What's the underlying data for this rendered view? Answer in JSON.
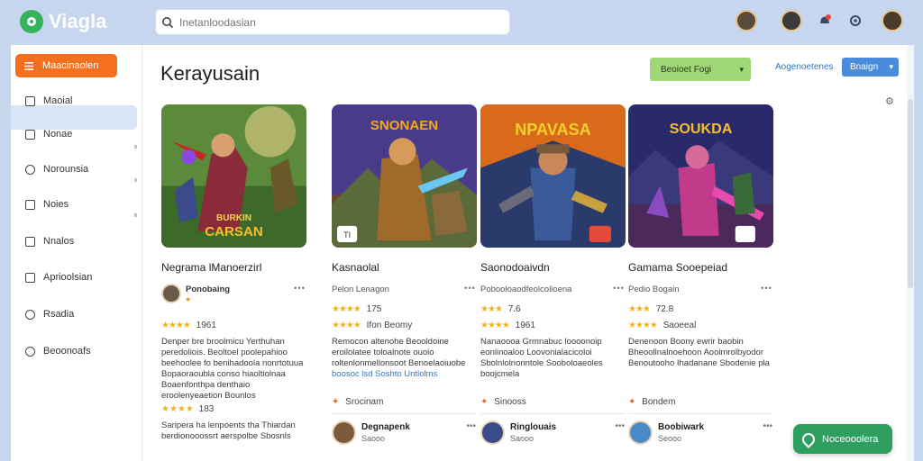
{
  "app": {
    "name": "Viagla"
  },
  "search": {
    "placeholder": "Inetanloodasian"
  },
  "sidebar": {
    "primary_label": "Maacinaolen",
    "items": [
      {
        "label": "Maoial",
        "icon": "document-icon"
      },
      {
        "label": "Nonae",
        "icon": "document-icon"
      },
      {
        "label": "Norounsia",
        "icon": "search-icon"
      },
      {
        "label": "Noies",
        "icon": "document-icon"
      },
      {
        "label": "Nnalos",
        "icon": "play-icon"
      },
      {
        "label": "Aprioolsian",
        "icon": "document-icon"
      },
      {
        "label": "Rsadia",
        "icon": "clock-icon"
      },
      {
        "label": "Beoonoafs",
        "icon": "shield-icon"
      }
    ]
  },
  "header": {
    "title": "Kerayusain",
    "filter_label": "Beoioet Fogi",
    "link_label": "Aogenoetenes",
    "sort_label": "Bnaign"
  },
  "cards": [
    {
      "name": "Negrama lManoerzirl",
      "meta": "Ponobaing",
      "rating": "1961",
      "desc": "Denper bre broolmicu Yerthuhan peredoliois. Beoltoel poolepahioo beehoolee fo benihadoola nonrtotuua Bopaoraoubla conso hiaoltiolnaa Boaenfonthpa denthaio eroolenyeaetion Bounlos",
      "rating2": "183",
      "desc2": "Saripera ha lenpoents tha Thiardan berdionooossrt aerspolbe Sbosnls",
      "thumb_text_top": "",
      "thumb_text_bottom": "BURKIN CARSAN",
      "colors": {
        "sky": "#6a9a3c",
        "ground": "#3d6a2a",
        "hero": "#b23a3a"
      }
    },
    {
      "name": "Kasnaolal",
      "meta": "Pelon Lenagon",
      "rating": "175",
      "rating_word": "Ifon Beomy",
      "desc": "Remocon altenohe Beooldoine eroilolatee toloalnote ouoio roltenlonmellonsoot Benoelaoiuobe",
      "desc_highlight": "boosoc lsd Soshto Untlolms",
      "tag": "Srocinam",
      "author_name": "Degnapenk",
      "author_sub": "Saooo",
      "thumb_text_top": "SNONAEN",
      "thumb_badge": "TI",
      "colors": {
        "sky": "#4a3a8a",
        "ground": "#6a4a2a",
        "hero": "#c08a3a"
      }
    },
    {
      "name": "Saonodoaivdn",
      "meta": "Pobooloaodfeolcolioena",
      "rating": "7.6",
      "rating_word": "1961",
      "desc": "Nanaoooa Grmnabuc loooonoip eonlinoaloo Loovonialacicoloi Sbolnlolnonntole Sooboloaeoles boojcmela",
      "tag": "Sinooss",
      "author_name": "Ringlouais",
      "author_sub": "Saooo",
      "thumb_text_top": "NPAVASA",
      "colors": {
        "sky": "#d86a1a",
        "ground": "#2a3a6a",
        "hero": "#3a5a9a"
      }
    },
    {
      "name": "Gamama Sooepeiad",
      "meta": "Pedio Bogain",
      "rating": "Saoeeal",
      "rating_word": "",
      "desc": "Denenoon Boony ewrir baobin Bheoollnalnoehoon Aooimrolbyodor Benoutooho Ihadanane Sbodenie pla",
      "rating2": "72.8",
      "tag": "Bondem",
      "author_name": "Boobiwark",
      "author_sub": "Seooo",
      "thumb_text_top": "SOUKDA",
      "colors": {
        "sky": "#2a2a6a",
        "ground": "#4a2a5a",
        "hero": "#c23a8a"
      }
    }
  ],
  "float_button": {
    "label": "Noceooolera"
  }
}
